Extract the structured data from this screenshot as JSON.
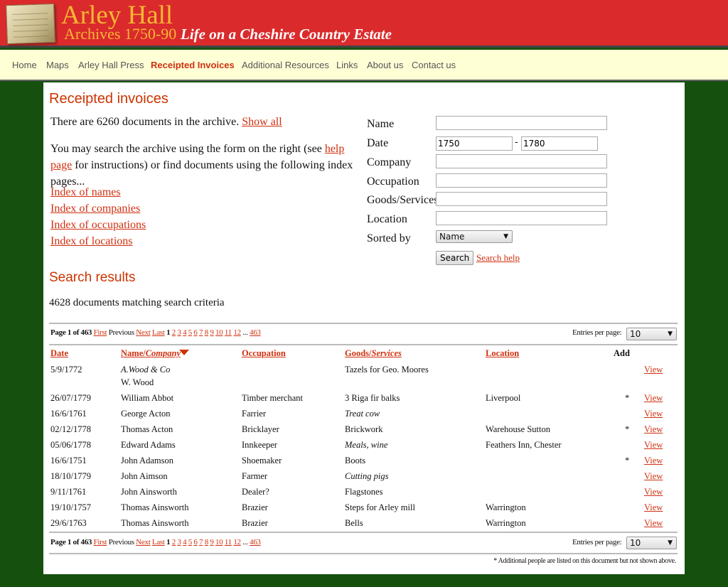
{
  "header": {
    "title": "Arley Hall",
    "subtitle": "Archives 1750-90",
    "tagline": "Life on a Cheshire Country Estate"
  },
  "nav": [
    {
      "label": "Home"
    },
    {
      "label": "Maps"
    },
    {
      "label": "Arley Hall Press"
    },
    {
      "label": "Receipted Invoices",
      "active": true
    },
    {
      "label": "Additional Resources"
    },
    {
      "label": "Links"
    },
    {
      "label": "About us"
    },
    {
      "label": "Contact us"
    }
  ],
  "page": {
    "title": "Receipted invoices",
    "count_text": "There are 6260 documents in the archive.",
    "show_all": "Show all",
    "intro_1": "You may search the archive using the form on the right (see",
    "help_link": "help page",
    "intro_2": "for instructions) or find documents using the following index pages...",
    "indexes": [
      "Index of names",
      "Index of companies",
      "Index of occupations",
      "Index of locations"
    ]
  },
  "form": {
    "name_label": "Name",
    "name_value": "",
    "date_label": "Date",
    "date_from": "1750",
    "date_sep": "-",
    "date_to": "1780",
    "company_label": "Company",
    "company_value": "",
    "occupation_label": "Occupation",
    "occupation_value": "",
    "goods_label": "Goods/Services",
    "goods_value": "",
    "location_label": "Location",
    "location_value": "",
    "sorted_label": "Sorted by",
    "sorted_value": "Name",
    "search_button": "Search",
    "search_help": "Search help"
  },
  "results": {
    "title": "Search results",
    "summary": "4628 documents matching search criteria"
  },
  "pager": {
    "page_text": "Page 1 of 463",
    "first": "First",
    "previous": "Previous",
    "next": "Next",
    "last": "Last",
    "current": "1",
    "pages": [
      "2",
      "3",
      "4",
      "5",
      "6",
      "7",
      "8",
      "9",
      "10",
      "11",
      "12"
    ],
    "ellipsis": "...",
    "last_page": "463",
    "entries_label": "Entries per page:",
    "entries_value": "10"
  },
  "table": {
    "headers": {
      "date": "Date",
      "name": "Name/",
      "company": "Company",
      "occupation": "Occupation",
      "goods": "Goods/",
      "services": "Services",
      "location": "Location",
      "add": "Add"
    },
    "rows": [
      {
        "date": "5/9/1772",
        "name": "A.Wood & Co",
        "name_italic": true,
        "name2": "W. Wood",
        "occupation": "",
        "goods": "Tazels for Geo. Moores",
        "goods_italic": false,
        "location": "",
        "add": "",
        "view": "View"
      },
      {
        "date": "26/07/1779",
        "name": "William Abbot",
        "occupation": "Timber merchant",
        "goods": "3 Riga fir balks",
        "location": "Liverpool",
        "add": "*",
        "view": "View"
      },
      {
        "date": "16/6/1761",
        "name": "George Acton",
        "occupation": "Farrier",
        "goods": "Treat cow",
        "goods_italic": true,
        "location": "",
        "add": "",
        "view": "View"
      },
      {
        "date": "02/12/1778",
        "name": "Thomas Acton",
        "occupation": "Bricklayer",
        "goods": "Brickwork",
        "location": "Warehouse Sutton",
        "add": "*",
        "view": "View"
      },
      {
        "date": "05/06/1778",
        "name": "Edward Adams",
        "occupation": "Innkeeper",
        "goods": "Meals, wine",
        "goods_italic": true,
        "location": "Feathers Inn, Chester",
        "add": "",
        "view": "View"
      },
      {
        "date": "16/6/1751",
        "name": "John Adamson",
        "occupation": "Shoemaker",
        "goods": "Boots",
        "location": "",
        "add": "*",
        "view": "View"
      },
      {
        "date": "18/10/1779",
        "name": "John Aimson",
        "occupation": "Farmer",
        "goods": "Cutting pigs",
        "goods_italic": true,
        "location": "",
        "add": "",
        "view": "View"
      },
      {
        "date": "9/11/1761",
        "name": "John Ainsworth",
        "occupation": "Dealer?",
        "goods": "Flagstones",
        "location": "",
        "add": "",
        "view": "View"
      },
      {
        "date": "19/10/1757",
        "name": "Thomas Ainsworth",
        "occupation": "Brazier",
        "goods": "Steps for Arley mill",
        "location": "Warrington",
        "add": "",
        "view": "View"
      },
      {
        "date": "29/6/1763",
        "name": "Thomas Ainsworth",
        "occupation": "Brazier",
        "goods": "Bells",
        "location": "Warrington",
        "add": "",
        "view": "View"
      }
    ]
  },
  "footnote": "* Additional people are listed on this document but not shown above.",
  "colors": {
    "header": "#da2a2c",
    "title": "#f7b733",
    "nav_bg": "#ffffd6",
    "accent": "#cc3300",
    "background": "#15500f"
  }
}
